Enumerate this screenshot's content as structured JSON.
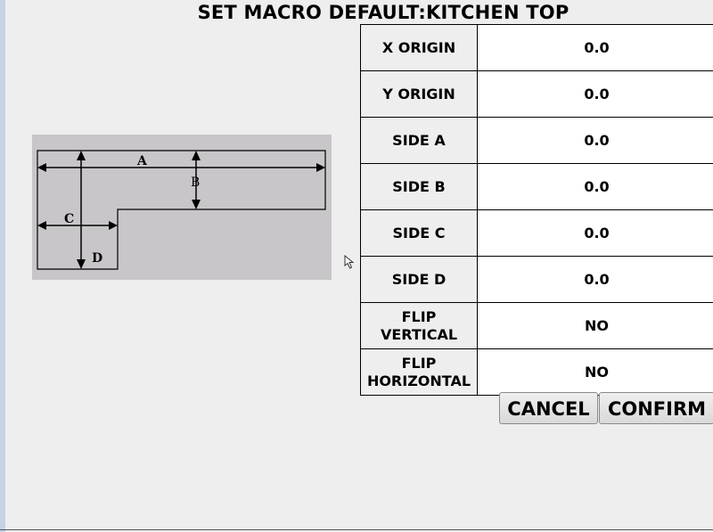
{
  "title": "SET MACRO DEFAULT:KITCHEN TOP",
  "diagram": {
    "labels": {
      "a": "A",
      "b": "B",
      "c": "C",
      "d": "D"
    },
    "background_color": "#c8c6c8"
  },
  "parameters": [
    {
      "label_lines": [
        "X ORIGIN"
      ],
      "value": "0.0"
    },
    {
      "label_lines": [
        "Y ORIGIN"
      ],
      "value": "0.0"
    },
    {
      "label_lines": [
        "SIDE A"
      ],
      "value": "0.0"
    },
    {
      "label_lines": [
        "SIDE B"
      ],
      "value": "0.0"
    },
    {
      "label_lines": [
        "SIDE C"
      ],
      "value": "0.0"
    },
    {
      "label_lines": [
        "SIDE D"
      ],
      "value": "0.0"
    },
    {
      "label_lines": [
        "FLIP",
        "VERTICAL"
      ],
      "value": "NO"
    },
    {
      "label_lines": [
        "FLIP",
        "HORIZONTAL"
      ],
      "value": "NO"
    }
  ],
  "buttons": {
    "cancel": "CANCEL",
    "confirm": "CONFIRM"
  },
  "icons": {
    "cursor": "mouse-pointer-icon"
  }
}
